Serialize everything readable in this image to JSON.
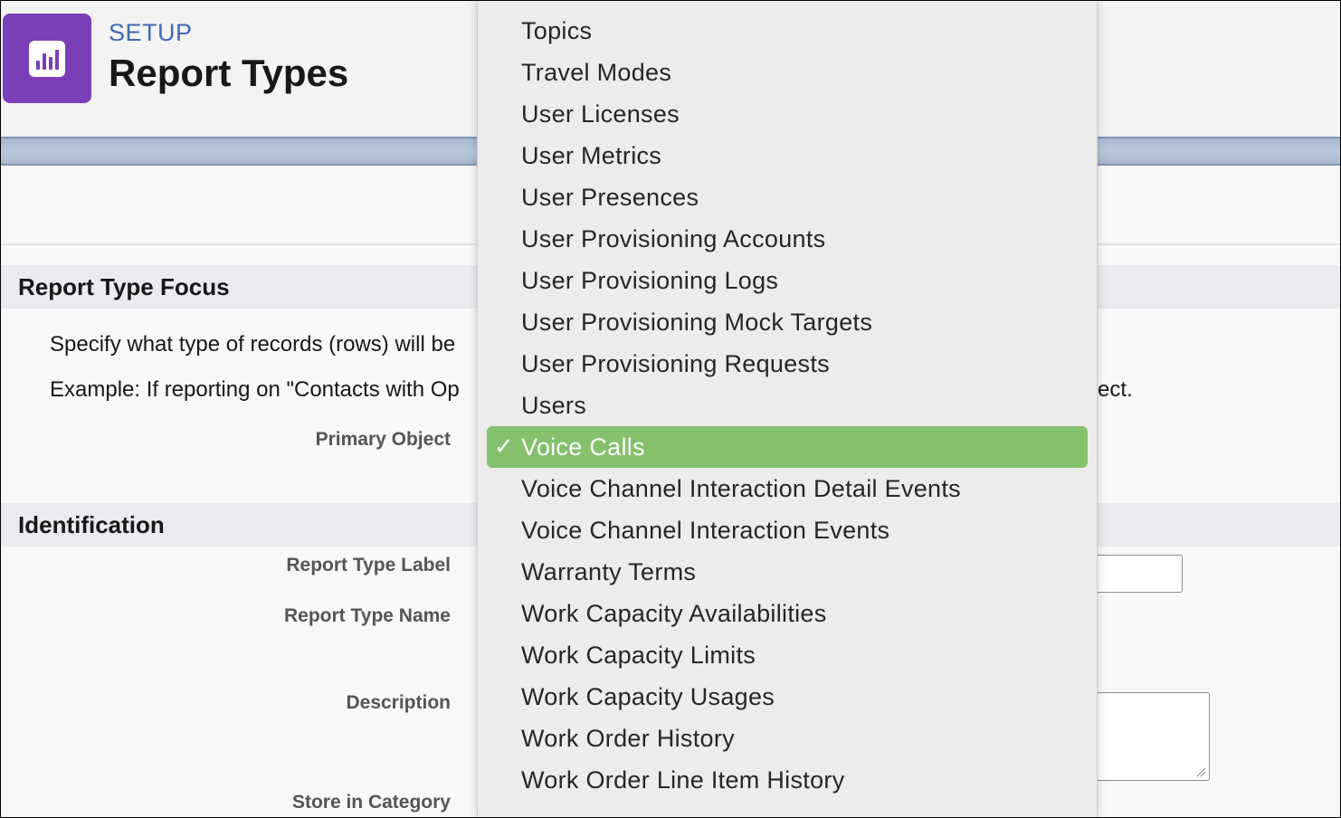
{
  "header": {
    "breadcrumb": "SETUP",
    "title": "Report Types",
    "icon": "report-chart-icon"
  },
  "colors": {
    "brand_purple": "#7a3fb8",
    "setup_blue": "#3d6ab1",
    "selected_green": "#85c06c"
  },
  "sections": {
    "focus": {
      "title": "Report Type Focus",
      "line1": "Specify what type of records (rows) will be",
      "line2": "Example: If reporting on \"Contacts with Op",
      "line2_tail": "ect.",
      "primary_object_label": "Primary Object"
    },
    "identification": {
      "title": "Identification",
      "report_type_label": "Report Type Label",
      "report_type_name": "Report Type Name",
      "description": "Description",
      "store_in_category": "Store in Category"
    }
  },
  "dropdown": {
    "items": [
      "Topics",
      "Travel Modes",
      "User Licenses",
      "User Metrics",
      "User Presences",
      "User Provisioning Accounts",
      "User Provisioning Logs",
      "User Provisioning Mock Targets",
      "User Provisioning Requests",
      "Users"
    ],
    "selected": {
      "check": "✓",
      "label": "Voice Calls"
    },
    "items_after": [
      "Voice Channel Interaction Detail Events",
      "Voice Channel Interaction Events",
      "Warranty Terms",
      "Work Capacity Availabilities",
      "Work Capacity Limits",
      "Work Capacity Usages",
      "Work Order History",
      "Work Order Line Item History"
    ]
  }
}
